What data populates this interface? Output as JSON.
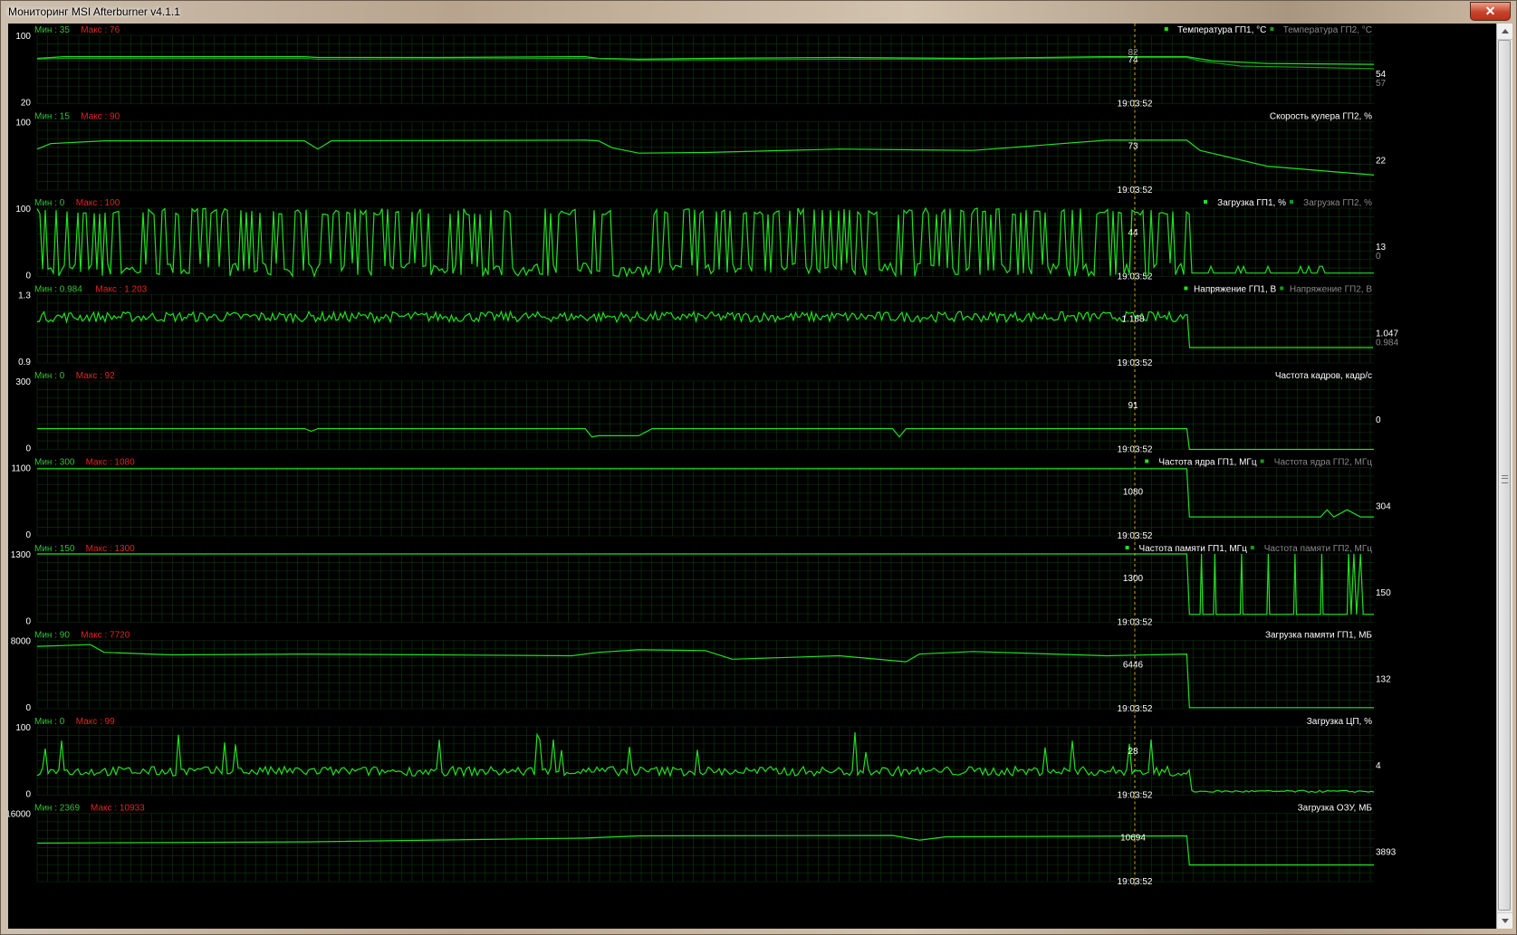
{
  "window": {
    "title": "Мониторинг MSI Afterburner v4.1.1",
    "close_label": "✕"
  },
  "cursor_time": "19:03:52",
  "colors": {
    "line": "#21e021",
    "line_dim": "#169916",
    "grid": "#0c3a0c",
    "min_label": "#2fc42f",
    "max_label": "#e52222",
    "legend_gray": "#8a8a8a",
    "cursor": "#d6a900",
    "axis_text": "#ffffff"
  },
  "chart_data": [
    {
      "type": "line",
      "title": "Температура ГП1, °C",
      "legend2": "Температура ГП2, °C",
      "min_label": "Мин : 35",
      "max_label": "Макс : 76",
      "y_max_label": "100",
      "y_min_label": "20",
      "ylim": [
        20,
        100
      ],
      "cursor_value": "74",
      "cursor_value2": "82",
      "end_value": "54",
      "end_value2": "57",
      "series": [
        {
          "name": "Температура ГП1, °C",
          "points": [
            [
              0,
              73
            ],
            [
              0.02,
              75
            ],
            [
              0.1,
              75
            ],
            [
              0.2,
              75
            ],
            [
              0.21,
              74
            ],
            [
              0.3,
              74
            ],
            [
              0.41,
              75
            ],
            [
              0.42,
              73
            ],
            [
              0.45,
              72
            ],
            [
              0.5,
              73
            ],
            [
              0.6,
              74
            ],
            [
              0.7,
              73
            ],
            [
              0.8,
              75
            ],
            [
              0.86,
              75
            ],
            [
              0.88,
              70
            ],
            [
              0.92,
              67
            ],
            [
              1,
              66
            ]
          ]
        },
        {
          "name": "Температура ГП2, °C",
          "points": [
            [
              0,
              72
            ],
            [
              0.02,
              73
            ],
            [
              0.2,
              73
            ],
            [
              0.21,
              72
            ],
            [
              0.41,
              73
            ],
            [
              0.45,
              71
            ],
            [
              0.6,
              72
            ],
            [
              0.7,
              72
            ],
            [
              0.8,
              74
            ],
            [
              0.86,
              74
            ],
            [
              0.87,
              70
            ],
            [
              0.9,
              64
            ],
            [
              1,
              61
            ]
          ]
        }
      ]
    },
    {
      "type": "line",
      "title": "Скорость кулера ГП2, %",
      "min_label": "Мин : 15",
      "max_label": "Макс : 90",
      "y_max_label": "100",
      "y_min_label": "",
      "ylim": [
        0,
        100
      ],
      "cursor_value": "73",
      "end_value": "22",
      "series": [
        {
          "name": "Скорость кулера ГП2, %",
          "points": [
            [
              0,
              60
            ],
            [
              0.01,
              68
            ],
            [
              0.05,
              72
            ],
            [
              0.2,
              72
            ],
            [
              0.21,
              60
            ],
            [
              0.22,
              72
            ],
            [
              0.41,
              73
            ],
            [
              0.42,
              72
            ],
            [
              0.43,
              62
            ],
            [
              0.45,
              54
            ],
            [
              0.5,
              55
            ],
            [
              0.6,
              60
            ],
            [
              0.7,
              58
            ],
            [
              0.8,
              73
            ],
            [
              0.86,
              73
            ],
            [
              0.87,
              58
            ],
            [
              0.92,
              35
            ],
            [
              1,
              22
            ]
          ]
        }
      ]
    },
    {
      "type": "line",
      "title": "Загрузка ГП1, %",
      "legend2": "Загрузка ГП2, %",
      "min_label": "Мин : 0",
      "max_label": "Макс : 100",
      "y_max_label": "100",
      "y_min_label": "0",
      "ylim": [
        0,
        100
      ],
      "cursor_value": "44",
      "end_value": "13",
      "end_value2": "0",
      "series": [
        {
          "name": "Загрузка ГП1, %",
          "pattern": "square_noise",
          "active_until": 0.862,
          "idle_value": 5,
          "gap": [
            0.43,
            0.46
          ]
        }
      ]
    },
    {
      "type": "line",
      "title": "Напряжение ГП1, В",
      "legend2": "Напряжение ГП2, В",
      "min_label": "Мин : 0.984",
      "max_label": "Макс : 1.203",
      "y_max_label": "1.3",
      "y_min_label": "0.9",
      "ylim": [
        0.9,
        1.3
      ],
      "cursor_value": "1.188",
      "end_value": "1.047",
      "end_value2": "0.984",
      "series": [
        {
          "name": "Напряжение ГП1, В",
          "pattern": "dense_noise",
          "active_until": 0.862,
          "center": 1.17,
          "amp": 0.03,
          "idle_value": 0.99
        }
      ]
    },
    {
      "type": "line",
      "title": "Частота кадров, кадр/с",
      "min_label": "Мин : 0",
      "max_label": "Макс : 92",
      "y_max_label": "300",
      "y_min_label": "0",
      "ylim": [
        0,
        300
      ],
      "cursor_value": "91",
      "end_value": "0",
      "series": [
        {
          "name": "Частота кадров, кадр/с",
          "points": [
            [
              0,
              91
            ],
            [
              0.2,
              91
            ],
            [
              0.205,
              80
            ],
            [
              0.21,
              91
            ],
            [
              0.41,
              91
            ],
            [
              0.415,
              55
            ],
            [
              0.42,
              60
            ],
            [
              0.45,
              60
            ],
            [
              0.46,
              91
            ],
            [
              0.64,
              91
            ],
            [
              0.645,
              55
            ],
            [
              0.65,
              91
            ],
            [
              0.86,
              91
            ],
            [
              0.862,
              0
            ],
            [
              1,
              0
            ]
          ]
        }
      ]
    },
    {
      "type": "line",
      "title": "Частота ядра ГП1, МГц",
      "legend2": "Частота ядра ГП2, МГц",
      "min_label": "Мин : 300",
      "max_label": "Макс : 1080",
      "y_max_label": "1100",
      "y_min_label": "0",
      "ylim": [
        0,
        1100
      ],
      "cursor_value": "1080",
      "end_value": "304",
      "series": [
        {
          "name": "Частота ядра ГП1, МГц",
          "points": [
            [
              0,
              1080
            ],
            [
              0.86,
              1080
            ],
            [
              0.862,
              304
            ],
            [
              0.96,
              304
            ],
            [
              0.965,
              420
            ],
            [
              0.97,
              304
            ],
            [
              0.98,
              420
            ],
            [
              0.99,
              304
            ],
            [
              1,
              304
            ]
          ]
        }
      ]
    },
    {
      "type": "line",
      "title": "Частота памяти ГП1, МГц",
      "legend2": "Частота памяти ГП2, МГц",
      "min_label": "Мин : 150",
      "max_label": "Макс : 1300",
      "y_max_label": "1300",
      "y_min_label": "0",
      "ylim": [
        0,
        1300
      ],
      "cursor_value": "1300",
      "end_value": "150",
      "series": [
        {
          "name": "Частота памяти ГП1, МГц",
          "points": [
            [
              0,
              1300
            ],
            [
              0.86,
              1300
            ],
            [
              0.862,
              150
            ],
            [
              0.87,
              150
            ],
            [
              0.871,
              1300
            ],
            [
              0.872,
              150
            ],
            [
              0.88,
              150
            ],
            [
              0.881,
              1300
            ],
            [
              0.882,
              150
            ],
            [
              0.9,
              150
            ],
            [
              0.901,
              1300
            ],
            [
              0.902,
              150
            ],
            [
              0.92,
              150
            ],
            [
              0.921,
              1300
            ],
            [
              0.922,
              150
            ],
            [
              0.94,
              150
            ],
            [
              0.941,
              1300
            ],
            [
              0.942,
              150
            ],
            [
              0.96,
              150
            ],
            [
              0.961,
              1300
            ],
            [
              0.962,
              150
            ],
            [
              0.98,
              150
            ],
            [
              0.981,
              1300
            ],
            [
              0.983,
              150
            ],
            [
              0.985,
              1300
            ],
            [
              0.987,
              150
            ],
            [
              0.99,
              1300
            ],
            [
              0.992,
              150
            ],
            [
              1,
              150
            ]
          ]
        }
      ]
    },
    {
      "type": "line",
      "title": "Загрузка памяти ГП1, МБ",
      "min_label": "Мин : 90",
      "max_label": "Макс : 7720",
      "y_max_label": "8000",
      "y_min_label": "0",
      "ylim": [
        0,
        8000
      ],
      "cursor_value": "6446",
      "end_value": "132",
      "series": [
        {
          "name": "Загрузка памяти ГП1, МБ",
          "points": [
            [
              0,
              7300
            ],
            [
              0.04,
              7500
            ],
            [
              0.05,
              6600
            ],
            [
              0.1,
              6300
            ],
            [
              0.2,
              6400
            ],
            [
              0.3,
              6300
            ],
            [
              0.4,
              6200
            ],
            [
              0.42,
              6600
            ],
            [
              0.45,
              6900
            ],
            [
              0.5,
              6800
            ],
            [
              0.52,
              5800
            ],
            [
              0.6,
              6200
            ],
            [
              0.65,
              5500
            ],
            [
              0.66,
              6400
            ],
            [
              0.7,
              6700
            ],
            [
              0.8,
              6200
            ],
            [
              0.86,
              6400
            ],
            [
              0.862,
              132
            ],
            [
              1,
              132
            ]
          ]
        }
      ]
    },
    {
      "type": "line",
      "title": "Загрузка ЦП, %",
      "min_label": "Мин : 0",
      "max_label": "Макс : 99",
      "y_max_label": "100",
      "y_min_label": "0",
      "ylim": [
        0,
        100
      ],
      "cursor_value": "28",
      "end_value": "4",
      "series": [
        {
          "name": "Загрузка ЦП, %",
          "pattern": "cpu_noise",
          "active_until": 0.862,
          "idle_value": 4
        }
      ]
    },
    {
      "type": "line",
      "title": "Загрузка ОЗУ, МБ",
      "min_label": "Мин : 2369",
      "max_label": "Макс : 10933",
      "y_max_label": "16000",
      "y_min_label": "",
      "ylim": [
        0,
        16000
      ],
      "cursor_value": "10694",
      "end_value": "3893",
      "series": [
        {
          "name": "Загрузка ОЗУ, МБ",
          "points": [
            [
              0,
              9000
            ],
            [
              0.2,
              9300
            ],
            [
              0.41,
              10200
            ],
            [
              0.45,
              10700
            ],
            [
              0.64,
              10800
            ],
            [
              0.66,
              9700
            ],
            [
              0.68,
              10500
            ],
            [
              0.86,
              10700
            ],
            [
              0.862,
              3893
            ],
            [
              1,
              3893
            ]
          ]
        }
      ]
    }
  ]
}
